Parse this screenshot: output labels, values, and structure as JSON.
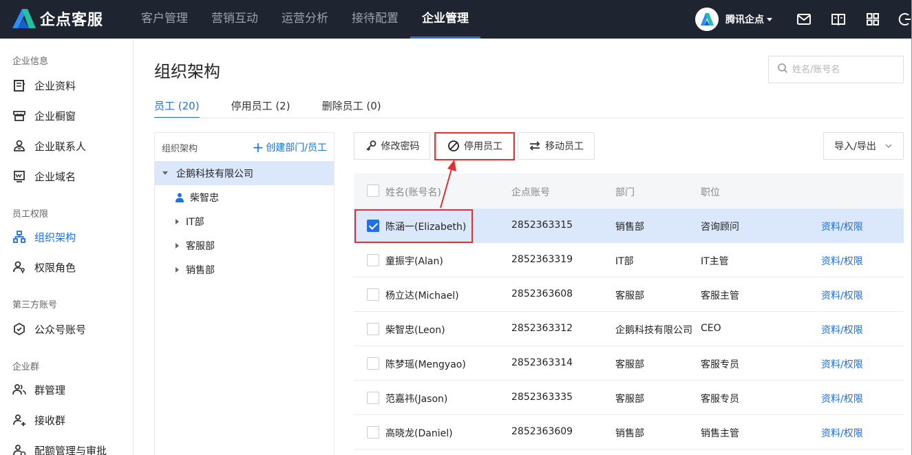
{
  "brand": {
    "name": "企点客服"
  },
  "nav": [
    "客户管理",
    "营销互动",
    "运营分析",
    "接待配置",
    "企业管理"
  ],
  "user": {
    "name": "腾讯企点"
  },
  "sidebar": {
    "groups": {
      "enterprise_info": "企业信息",
      "staff_rights": "员工权限",
      "third_party": "第三方账号",
      "enterprise_group": "企业群"
    },
    "items": {
      "profile": "企业资料",
      "showcase": "企业橱窗",
      "contacts": "企业联系人",
      "domain": "企业域名",
      "org": "组织架构",
      "roles": "权限角色",
      "official": "公众号账号",
      "group_mgmt": "群管理",
      "receive_group": "接收群",
      "quota": "配额管理与审批"
    }
  },
  "page": {
    "title": "组织架构",
    "search_placeholder": "姓名/账号名",
    "tabs": [
      "员工 (20)",
      "停用员工 (2)",
      "删除员工 (0)"
    ]
  },
  "tree": {
    "header": "组织架构",
    "create": "创建部门/员工",
    "nodes": [
      "企鹅科技有限公司",
      "柴智忠",
      "IT部",
      "客服部",
      "销售部"
    ]
  },
  "toolbar": {
    "change_password": "修改密码",
    "disable": "停用员工",
    "move": "移动员工",
    "import_export": "导入/导出"
  },
  "table": {
    "headers": [
      "姓名(账号名)",
      "企点账号",
      "部门",
      "职位"
    ],
    "action_label": "资料/权限",
    "rows": [
      {
        "name": "陈涵一(Elizabeth)",
        "account": "2852363315",
        "dept": "销售部",
        "position": "咨询顾问"
      },
      {
        "name": "童振宇(Alan)",
        "account": "2852363319",
        "dept": "IT部",
        "position": "IT主管"
      },
      {
        "name": "杨立达(Michael)",
        "account": "2852363608",
        "dept": "客服部",
        "position": "客服主管"
      },
      {
        "name": "柴智忠(Leon)",
        "account": "2852363312",
        "dept": "企鹅科技有限公司",
        "position": "CEO"
      },
      {
        "name": "陈梦瑶(Mengyao)",
        "account": "2852363314",
        "dept": "客服部",
        "position": "客服专员"
      },
      {
        "name": "范嘉祎(Jason)",
        "account": "2852363335",
        "dept": "客服部",
        "position": "客服专员"
      },
      {
        "name": "高晓龙(Daniel)",
        "account": "2852363609",
        "dept": "销售部",
        "position": "销售主管"
      }
    ]
  },
  "colors": {
    "accent": "#1f6fe5",
    "topbar": "#1e2430",
    "highlight": "#e03131",
    "selected_row": "#dbe8fb"
  }
}
